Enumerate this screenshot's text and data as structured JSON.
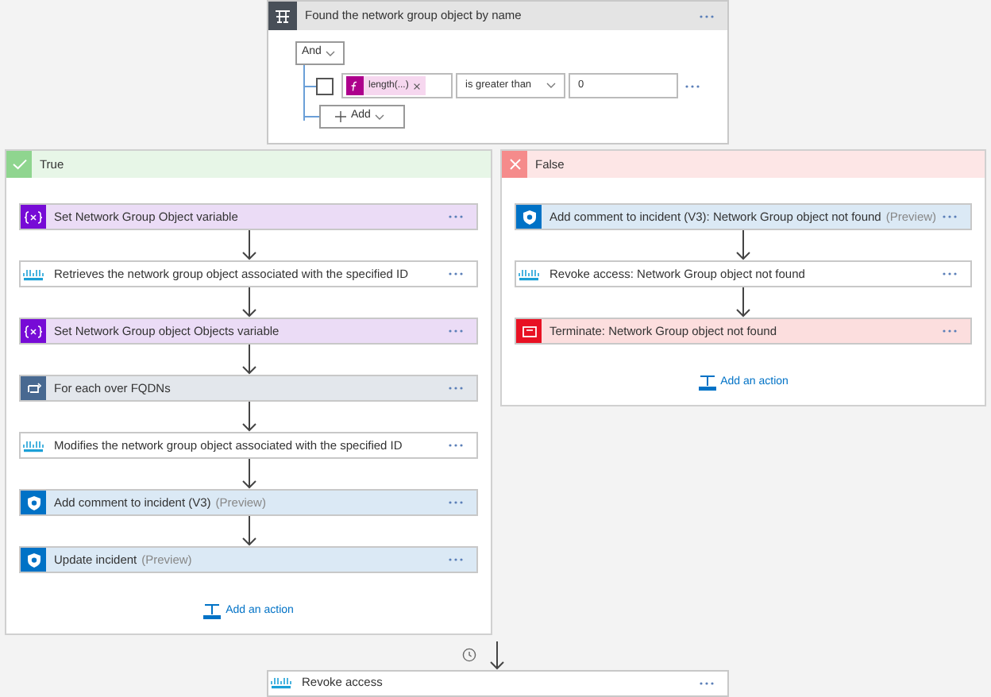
{
  "condition": {
    "title": "Found the network group object by name",
    "group_operator": "And",
    "checked": false,
    "token": "length(...)",
    "operator": "is greater than",
    "value": "0",
    "add_label": "Add"
  },
  "branches": [
    {
      "kind": "true",
      "label": "True",
      "steps": [
        {
          "kind": "variable",
          "title": "Set Network Group Object variable"
        },
        {
          "kind": "cisco",
          "title": "Retrieves the network group object associated with the specified ID"
        },
        {
          "kind": "variable",
          "title": "Set Network Group object Objects variable"
        },
        {
          "kind": "foreach",
          "title": "For each over FQDNs"
        },
        {
          "kind": "cisco",
          "title": "Modifies the network group object associated with the specified ID"
        },
        {
          "kind": "sentinel",
          "title": "Add comment to incident (V3)",
          "suffix": "(Preview)"
        },
        {
          "kind": "sentinel",
          "title": "Update incident",
          "suffix": "(Preview)"
        }
      ],
      "add_action": "Add an action"
    },
    {
      "kind": "false",
      "label": "False",
      "steps": [
        {
          "kind": "sentinel",
          "title": "Add comment to incident (V3): Network Group object not found",
          "suffix": "(Preview)"
        },
        {
          "kind": "cisco",
          "title": "Revoke access: Network Group object not found"
        },
        {
          "kind": "terminate",
          "title": "Terminate: Network Group object not found"
        }
      ],
      "add_action": "Add an action"
    }
  ],
  "next_step": {
    "kind": "cisco",
    "title": "Revoke access"
  }
}
